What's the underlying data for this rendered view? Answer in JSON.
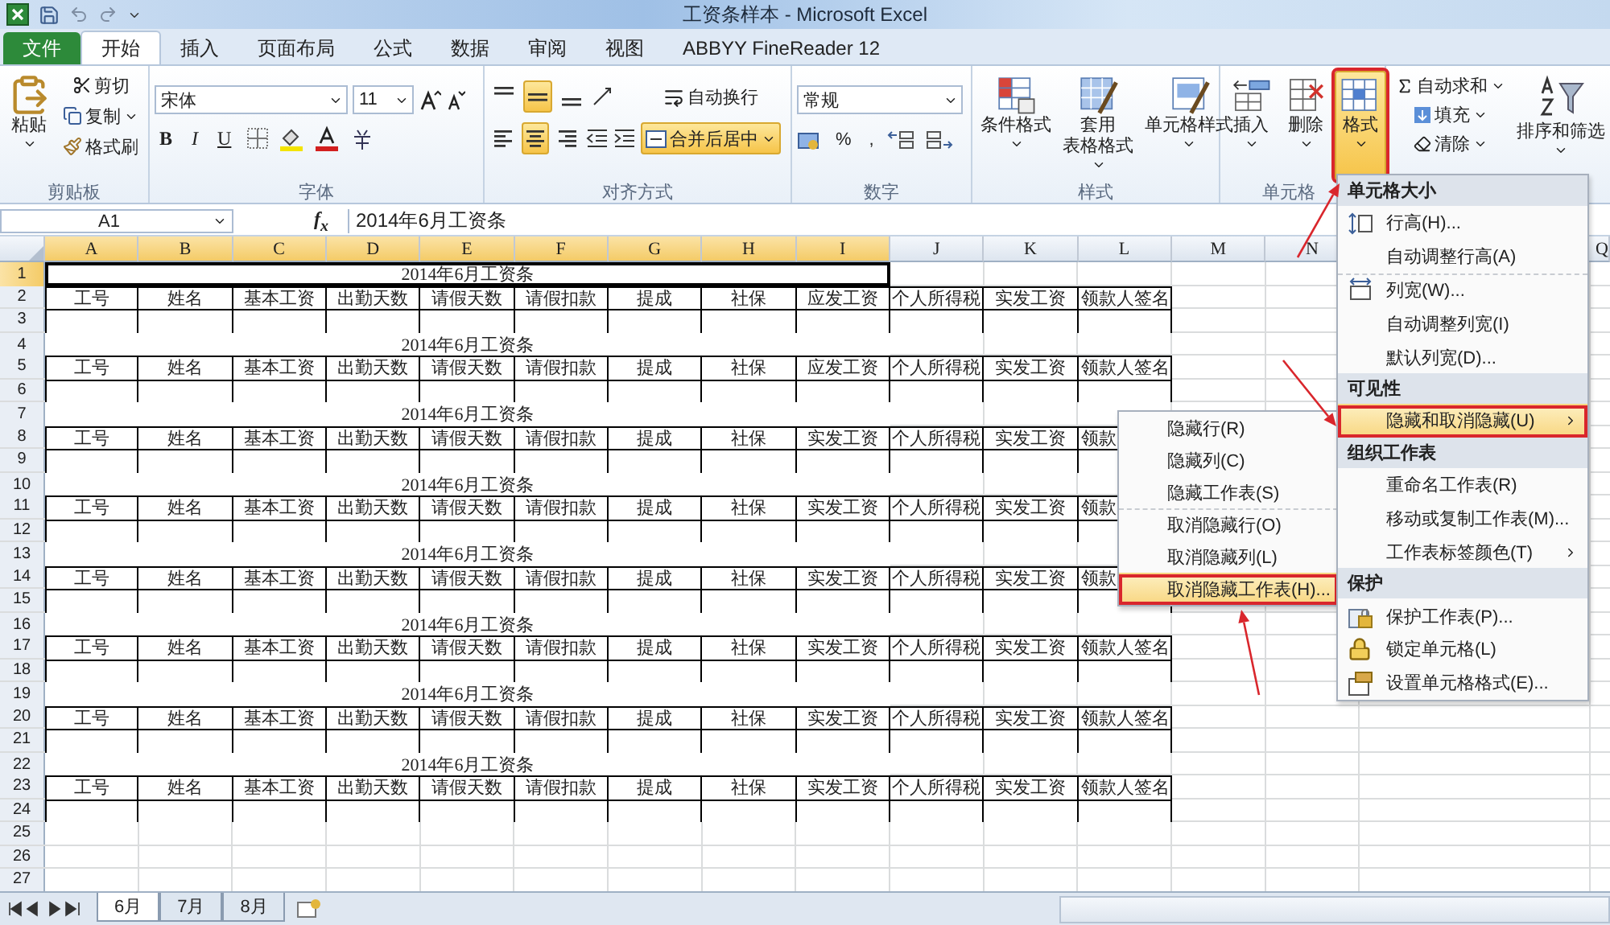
{
  "title_bar": {
    "title": "工资条样本 - Microsoft Excel"
  },
  "tabs": [
    {
      "label": "文件",
      "kind": "file",
      "selected": false
    },
    {
      "label": "开始",
      "kind": "tab",
      "selected": true
    },
    {
      "label": "插入",
      "kind": "tab",
      "selected": false
    },
    {
      "label": "页面布局",
      "kind": "tab",
      "selected": false
    },
    {
      "label": "公式",
      "kind": "tab",
      "selected": false
    },
    {
      "label": "数据",
      "kind": "tab",
      "selected": false
    },
    {
      "label": "审阅",
      "kind": "tab",
      "selected": false
    },
    {
      "label": "视图",
      "kind": "tab",
      "selected": false
    },
    {
      "label": "ABBYY FineReader 12",
      "kind": "tab",
      "selected": false
    }
  ],
  "clipboard": {
    "label": "剪贴板",
    "paste": "粘贴",
    "cut": "剪切",
    "copy": "复制",
    "format_painter": "格式刷"
  },
  "font": {
    "label": "字体",
    "font_name": "宋体",
    "font_size": "11",
    "format_buttons": [
      "B",
      "I",
      "U"
    ]
  },
  "alignment": {
    "label": "对齐方式",
    "vertical": [
      {
        "selected": false
      },
      {
        "selected": true
      },
      {
        "selected": false
      }
    ],
    "horizontal": [
      {
        "selected": false
      },
      {
        "selected": true
      },
      {
        "selected": false
      }
    ],
    "wrap_text": "自动换行",
    "merge_center": {
      "label": "合并后居中",
      "selected": true
    }
  },
  "number": {
    "label": "数字",
    "format": "常规",
    "percent": "%",
    "comma": ","
  },
  "styles": {
    "label": "样式",
    "buttons": [
      {
        "lines": [
          "条件格式"
        ],
        "kind": "conditional"
      },
      {
        "lines": [
          "套用",
          "表格格式"
        ],
        "kind": "table"
      },
      {
        "lines": [
          "单元格样式"
        ],
        "kind": "cellstyle"
      }
    ]
  },
  "cells": {
    "label": "单元格",
    "buttons": [
      {
        "label": "插入",
        "kind": "insert",
        "selected": false,
        "annotated": false
      },
      {
        "label": "删除",
        "kind": "delete",
        "selected": false,
        "annotated": false
      },
      {
        "label": "格式",
        "kind": "format",
        "selected": true,
        "annotated": true
      }
    ]
  },
  "editing": {
    "autosum": "自动求和",
    "fill": "填充",
    "clear": "清除",
    "sort_filter": "排序和筛选"
  },
  "formula_bar": {
    "name_box": "A1",
    "fx": "f$_{x}$",
    "formula": "2014年6月工资条"
  },
  "sheet": {
    "columns": [
      {
        "label": "A",
        "selected": true
      },
      {
        "label": "B",
        "selected": true
      },
      {
        "label": "C",
        "selected": true
      },
      {
        "label": "D",
        "selected": true
      },
      {
        "label": "E",
        "selected": true
      },
      {
        "label": "F",
        "selected": true
      },
      {
        "label": "G",
        "selected": true
      },
      {
        "label": "H",
        "selected": true
      },
      {
        "label": "I",
        "selected": true
      },
      {
        "label": "J",
        "selected": false
      },
      {
        "label": "K",
        "selected": false
      },
      {
        "label": "L",
        "selected": false
      },
      {
        "label": "M",
        "selected": false
      },
      {
        "label": "N",
        "selected": false
      }
    ],
    "right_columns": [
      {
        "label": "Q",
        "selected": false
      }
    ],
    "rows": [
      {
        "n": "1",
        "kind": "title",
        "selected": true,
        "text": "2014年6月工资条"
      },
      {
        "n": "2",
        "kind": "header",
        "selected": false,
        "cells": [
          "工号",
          "姓名",
          "基本工资",
          "出勤天数",
          "请假天数",
          "请假扣款",
          "提成",
          "社保",
          "应发工资",
          "个人所得税",
          "实发工资",
          "领款人签名"
        ]
      },
      {
        "n": "3",
        "kind": "blank",
        "selected": false
      },
      {
        "n": "4",
        "kind": "title",
        "selected": false,
        "text": "2014年6月工资条"
      },
      {
        "n": "5",
        "kind": "header",
        "selected": false,
        "cells": [
          "工号",
          "姓名",
          "基本工资",
          "出勤天数",
          "请假天数",
          "请假扣款",
          "提成",
          "社保",
          "应发工资",
          "个人所得税",
          "实发工资",
          "领款人签名"
        ]
      },
      {
        "n": "6",
        "kind": "blank",
        "selected": false
      },
      {
        "n": "7",
        "kind": "title",
        "selected": false,
        "text": "2014年6月工资条"
      },
      {
        "n": "8",
        "kind": "header",
        "selected": false,
        "cells": [
          "工号",
          "姓名",
          "基本工资",
          "出勤天数",
          "请假天数",
          "请假扣款",
          "提成",
          "社保",
          "实发工资",
          "个人所得税",
          "实发工资",
          "领款"
        ]
      },
      {
        "n": "9",
        "kind": "blank",
        "selected": false
      },
      {
        "n": "10",
        "kind": "title",
        "selected": false,
        "text": "2014年6月工资条"
      },
      {
        "n": "11",
        "kind": "header",
        "selected": false,
        "cells": [
          "工号",
          "姓名",
          "基本工资",
          "出勤天数",
          "请假天数",
          "请假扣款",
          "提成",
          "社保",
          "实发工资",
          "个人所得税",
          "实发工资",
          "领款"
        ]
      },
      {
        "n": "12",
        "kind": "blank",
        "selected": false
      },
      {
        "n": "13",
        "kind": "title",
        "selected": false,
        "text": "2014年6月工资条"
      },
      {
        "n": "14",
        "kind": "header",
        "selected": false,
        "cells": [
          "工号",
          "姓名",
          "基本工资",
          "出勤天数",
          "请假天数",
          "请假扣款",
          "提成",
          "社保",
          "实发工资",
          "个人所得税",
          "实发工资",
          "领款"
        ]
      },
      {
        "n": "15",
        "kind": "blank",
        "selected": false
      },
      {
        "n": "16",
        "kind": "title",
        "selected": false,
        "text": "2014年6月工资条"
      },
      {
        "n": "17",
        "kind": "header",
        "selected": false,
        "cells": [
          "工号",
          "姓名",
          "基本工资",
          "出勤天数",
          "请假天数",
          "请假扣款",
          "提成",
          "社保",
          "实发工资",
          "个人所得税",
          "实发工资",
          "领款人签名"
        ]
      },
      {
        "n": "18",
        "kind": "blank",
        "selected": false
      },
      {
        "n": "19",
        "kind": "title",
        "selected": false,
        "text": "2014年6月工资条"
      },
      {
        "n": "20",
        "kind": "header",
        "selected": false,
        "cells": [
          "工号",
          "姓名",
          "基本工资",
          "出勤天数",
          "请假天数",
          "请假扣款",
          "提成",
          "社保",
          "实发工资",
          "个人所得税",
          "实发工资",
          "领款人签名"
        ]
      },
      {
        "n": "21",
        "kind": "blank",
        "selected": false
      },
      {
        "n": "22",
        "kind": "title",
        "selected": false,
        "text": "2014年6月工资条"
      },
      {
        "n": "23",
        "kind": "header",
        "selected": false,
        "cells": [
          "工号",
          "姓名",
          "基本工资",
          "出勤天数",
          "请假天数",
          "请假扣款",
          "提成",
          "社保",
          "实发工资",
          "个人所得税",
          "实发工资",
          "领款人签名"
        ]
      },
      {
        "n": "24",
        "kind": "blank",
        "selected": false
      },
      {
        "n": "25",
        "kind": "empty",
        "selected": false
      },
      {
        "n": "26",
        "kind": "empty",
        "selected": false
      },
      {
        "n": "27",
        "kind": "empty",
        "selected": false
      }
    ]
  },
  "format_menu": {
    "sections": [
      {
        "heading": "单元格大小",
        "items": [
          {
            "label": "行高(H)...",
            "kind": "row_height",
            "selected": false,
            "annotated": false
          },
          {
            "label": "自动调整行高(A)",
            "selected": false,
            "annotated": false
          },
          {
            "label": "列宽(W)...",
            "kind": "col_width",
            "separator_before": true,
            "selected": false,
            "annotated": false
          },
          {
            "label": "自动调整列宽(I)",
            "selected": false,
            "annotated": false
          },
          {
            "label": "默认列宽(D)...",
            "selected": false,
            "annotated": false
          }
        ]
      },
      {
        "heading": "可见性",
        "items": [
          {
            "label": "隐藏和取消隐藏(U)",
            "submenu": true,
            "selected": true,
            "annotated": true
          }
        ]
      },
      {
        "heading": "组织工作表",
        "items": [
          {
            "label": "重命名工作表(R)",
            "selected": false,
            "annotated": false
          },
          {
            "label": "移动或复制工作表(M)...",
            "selected": false,
            "annotated": false
          },
          {
            "label": "工作表标签颜色(T)",
            "submenu": true,
            "selected": false,
            "annotated": false
          }
        ]
      },
      {
        "heading": "保护",
        "items": [
          {
            "label": "保护工作表(P)...",
            "kind": "protect",
            "selected": false,
            "annotated": false
          },
          {
            "label": "锁定单元格(L)",
            "kind": "lock",
            "selected": false,
            "annotated": false
          },
          {
            "label": "设置单元格格式(E)...",
            "kind": "format_cells",
            "selected": false,
            "annotated": false
          }
        ]
      }
    ]
  },
  "submenu": {
    "items": [
      {
        "label": "隐藏行(R)",
        "selected": false,
        "annotated": false
      },
      {
        "label": "隐藏列(C)",
        "selected": false,
        "annotated": false
      },
      {
        "label": "隐藏工作表(S)",
        "selected": false,
        "annotated": false
      },
      {
        "label": "取消隐藏行(O)",
        "separator_before": true,
        "selected": false,
        "annotated": false
      },
      {
        "label": "取消隐藏列(L)",
        "selected": false,
        "annotated": false
      },
      {
        "label": "取消隐藏工作表(H)...",
        "selected": true,
        "annotated": true
      }
    ]
  },
  "sheet_tabs": [
    {
      "label": "6月",
      "selected": true
    },
    {
      "label": "7月",
      "selected": false
    },
    {
      "label": "8月",
      "selected": false
    }
  ]
}
